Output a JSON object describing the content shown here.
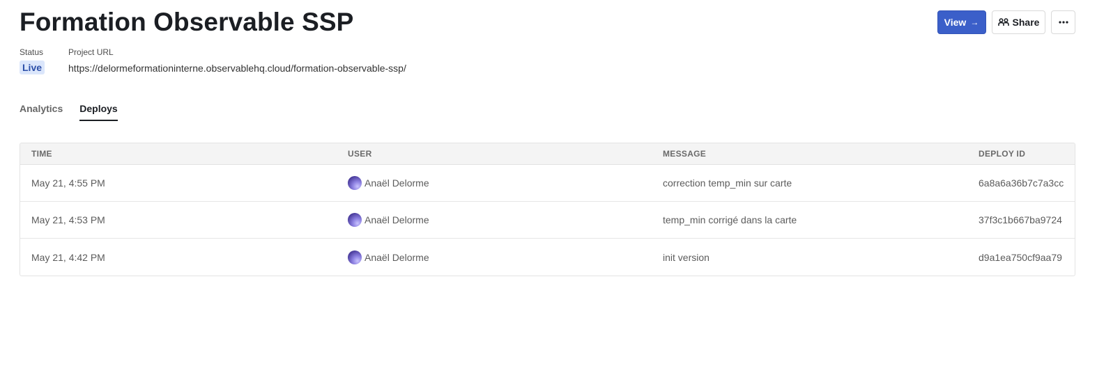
{
  "header": {
    "title": "Formation Observable SSP",
    "view_label": "View",
    "view_arrow": "→",
    "share_label": "Share"
  },
  "meta": {
    "status_label": "Status",
    "status_value": "Live",
    "url_label": "Project URL",
    "url_value": "https://delormeformationinterne.observablehq.cloud/formation-observable-ssp/"
  },
  "tabs": [
    {
      "label": "Analytics",
      "active": false
    },
    {
      "label": "Deploys",
      "active": true
    }
  ],
  "table": {
    "columns": [
      "TIME",
      "USER",
      "MESSAGE",
      "DEPLOY ID"
    ],
    "rows": [
      {
        "time": "May 21, 4:55 PM",
        "user": "Anaël Delorme",
        "message": "correction temp_min sur carte",
        "deploy_id": "6a8a6a36b7c7a3cc"
      },
      {
        "time": "May 21, 4:53 PM",
        "user": "Anaël Delorme",
        "message": "temp_min corrigé dans la carte",
        "deploy_id": "37f3c1b667ba9724"
      },
      {
        "time": "May 21, 4:42 PM",
        "user": "Anaël Delorme",
        "message": "init version",
        "deploy_id": "d9a1ea750cf9aa79"
      }
    ]
  },
  "colors": {
    "accent": "#3b5fc9",
    "badge_bg": "#dbe6fb",
    "badge_text": "#2c4fa8"
  },
  "icons": {
    "view": "arrow-right-icon",
    "share": "share-people-icon",
    "more": "ellipsis-icon",
    "avatar": "user-avatar-icon"
  }
}
